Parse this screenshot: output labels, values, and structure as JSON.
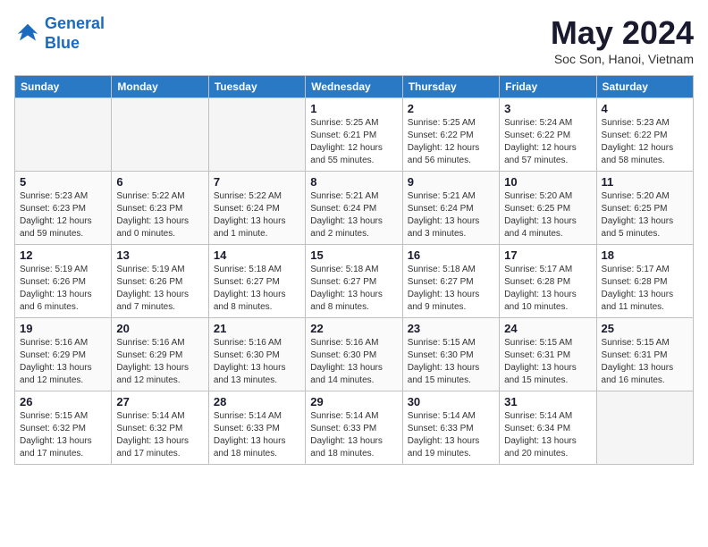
{
  "logo": {
    "line1": "General",
    "line2": "Blue"
  },
  "title": "May 2024",
  "subtitle": "Soc Son, Hanoi, Vietnam",
  "days_of_week": [
    "Sunday",
    "Monday",
    "Tuesday",
    "Wednesday",
    "Thursday",
    "Friday",
    "Saturday"
  ],
  "weeks": [
    [
      {
        "num": "",
        "info": ""
      },
      {
        "num": "",
        "info": ""
      },
      {
        "num": "",
        "info": ""
      },
      {
        "num": "1",
        "info": "Sunrise: 5:25 AM\nSunset: 6:21 PM\nDaylight: 12 hours\nand 55 minutes."
      },
      {
        "num": "2",
        "info": "Sunrise: 5:25 AM\nSunset: 6:22 PM\nDaylight: 12 hours\nand 56 minutes."
      },
      {
        "num": "3",
        "info": "Sunrise: 5:24 AM\nSunset: 6:22 PM\nDaylight: 12 hours\nand 57 minutes."
      },
      {
        "num": "4",
        "info": "Sunrise: 5:23 AM\nSunset: 6:22 PM\nDaylight: 12 hours\nand 58 minutes."
      }
    ],
    [
      {
        "num": "5",
        "info": "Sunrise: 5:23 AM\nSunset: 6:23 PM\nDaylight: 12 hours\nand 59 minutes."
      },
      {
        "num": "6",
        "info": "Sunrise: 5:22 AM\nSunset: 6:23 PM\nDaylight: 13 hours\nand 0 minutes."
      },
      {
        "num": "7",
        "info": "Sunrise: 5:22 AM\nSunset: 6:24 PM\nDaylight: 13 hours\nand 1 minute."
      },
      {
        "num": "8",
        "info": "Sunrise: 5:21 AM\nSunset: 6:24 PM\nDaylight: 13 hours\nand 2 minutes."
      },
      {
        "num": "9",
        "info": "Sunrise: 5:21 AM\nSunset: 6:24 PM\nDaylight: 13 hours\nand 3 minutes."
      },
      {
        "num": "10",
        "info": "Sunrise: 5:20 AM\nSunset: 6:25 PM\nDaylight: 13 hours\nand 4 minutes."
      },
      {
        "num": "11",
        "info": "Sunrise: 5:20 AM\nSunset: 6:25 PM\nDaylight: 13 hours\nand 5 minutes."
      }
    ],
    [
      {
        "num": "12",
        "info": "Sunrise: 5:19 AM\nSunset: 6:26 PM\nDaylight: 13 hours\nand 6 minutes."
      },
      {
        "num": "13",
        "info": "Sunrise: 5:19 AM\nSunset: 6:26 PM\nDaylight: 13 hours\nand 7 minutes."
      },
      {
        "num": "14",
        "info": "Sunrise: 5:18 AM\nSunset: 6:27 PM\nDaylight: 13 hours\nand 8 minutes."
      },
      {
        "num": "15",
        "info": "Sunrise: 5:18 AM\nSunset: 6:27 PM\nDaylight: 13 hours\nand 8 minutes."
      },
      {
        "num": "16",
        "info": "Sunrise: 5:18 AM\nSunset: 6:27 PM\nDaylight: 13 hours\nand 9 minutes."
      },
      {
        "num": "17",
        "info": "Sunrise: 5:17 AM\nSunset: 6:28 PM\nDaylight: 13 hours\nand 10 minutes."
      },
      {
        "num": "18",
        "info": "Sunrise: 5:17 AM\nSunset: 6:28 PM\nDaylight: 13 hours\nand 11 minutes."
      }
    ],
    [
      {
        "num": "19",
        "info": "Sunrise: 5:16 AM\nSunset: 6:29 PM\nDaylight: 13 hours\nand 12 minutes."
      },
      {
        "num": "20",
        "info": "Sunrise: 5:16 AM\nSunset: 6:29 PM\nDaylight: 13 hours\nand 12 minutes."
      },
      {
        "num": "21",
        "info": "Sunrise: 5:16 AM\nSunset: 6:30 PM\nDaylight: 13 hours\nand 13 minutes."
      },
      {
        "num": "22",
        "info": "Sunrise: 5:16 AM\nSunset: 6:30 PM\nDaylight: 13 hours\nand 14 minutes."
      },
      {
        "num": "23",
        "info": "Sunrise: 5:15 AM\nSunset: 6:30 PM\nDaylight: 13 hours\nand 15 minutes."
      },
      {
        "num": "24",
        "info": "Sunrise: 5:15 AM\nSunset: 6:31 PM\nDaylight: 13 hours\nand 15 minutes."
      },
      {
        "num": "25",
        "info": "Sunrise: 5:15 AM\nSunset: 6:31 PM\nDaylight: 13 hours\nand 16 minutes."
      }
    ],
    [
      {
        "num": "26",
        "info": "Sunrise: 5:15 AM\nSunset: 6:32 PM\nDaylight: 13 hours\nand 17 minutes."
      },
      {
        "num": "27",
        "info": "Sunrise: 5:14 AM\nSunset: 6:32 PM\nDaylight: 13 hours\nand 17 minutes."
      },
      {
        "num": "28",
        "info": "Sunrise: 5:14 AM\nSunset: 6:33 PM\nDaylight: 13 hours\nand 18 minutes."
      },
      {
        "num": "29",
        "info": "Sunrise: 5:14 AM\nSunset: 6:33 PM\nDaylight: 13 hours\nand 18 minutes."
      },
      {
        "num": "30",
        "info": "Sunrise: 5:14 AM\nSunset: 6:33 PM\nDaylight: 13 hours\nand 19 minutes."
      },
      {
        "num": "31",
        "info": "Sunrise: 5:14 AM\nSunset: 6:34 PM\nDaylight: 13 hours\nand 20 minutes."
      },
      {
        "num": "",
        "info": ""
      }
    ]
  ]
}
